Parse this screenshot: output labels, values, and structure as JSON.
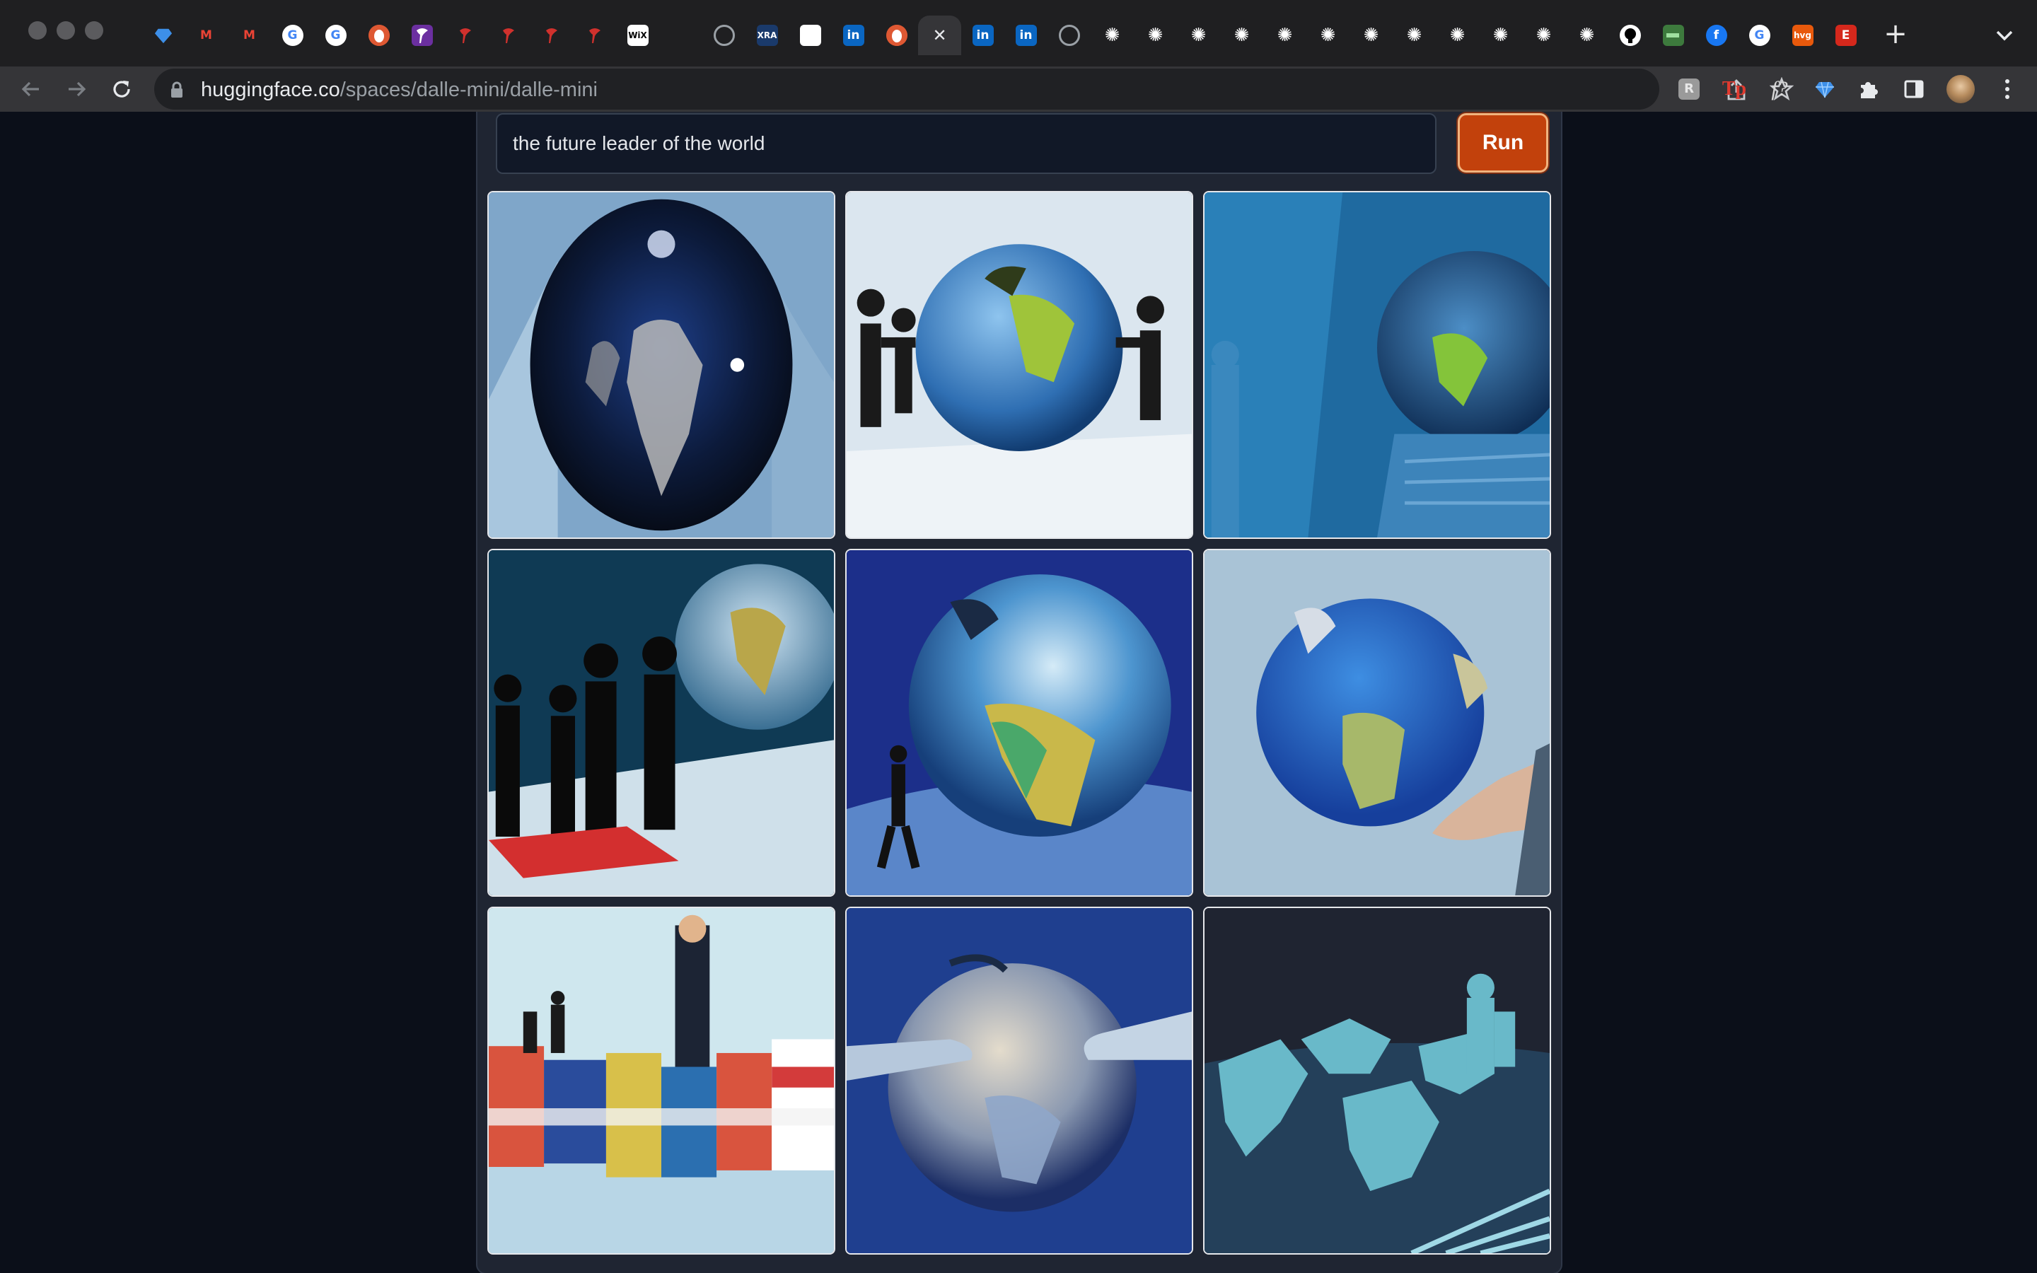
{
  "browser": {
    "url_host": "huggingface.co",
    "url_path": "/spaces/dalle-mini/dalle-mini",
    "tabs": [
      {
        "icon": "diamond-icon",
        "label": "",
        "bg": "transparent",
        "color": "#4a90e2"
      },
      {
        "icon": "gmail-icon",
        "label": "M",
        "bg": "transparent",
        "color": "#ea4335"
      },
      {
        "icon": "gmail-icon",
        "label": "M",
        "bg": "transparent",
        "color": "#ea4335"
      },
      {
        "icon": "google-icon",
        "label": "G",
        "bg": "#ffffff",
        "color": "#4285f4"
      },
      {
        "icon": "google-icon",
        "label": "G",
        "bg": "#ffffff",
        "color": "#4285f4"
      },
      {
        "icon": "duckduckgo-icon",
        "label": "",
        "bg": "#de5833",
        "color": "#ffffff"
      },
      {
        "icon": "purple-pin-icon",
        "label": "",
        "bg": "#6b2fa0",
        "color": "#ffffff"
      },
      {
        "icon": "red-pin-icon",
        "label": "",
        "bg": "transparent",
        "color": "#d0312d"
      },
      {
        "icon": "red-pin-icon",
        "label": "",
        "bg": "transparent",
        "color": "#d0312d"
      },
      {
        "icon": "red-pin-icon",
        "label": "",
        "bg": "transparent",
        "color": "#d0312d"
      },
      {
        "icon": "red-pin-icon",
        "label": "",
        "bg": "transparent",
        "color": "#d0312d"
      },
      {
        "icon": "wix-icon",
        "label": "WiX",
        "bg": "#ffffff",
        "color": "#000000"
      },
      {
        "icon": "blank-icon",
        "label": "",
        "bg": "transparent",
        "color": "#ffffff"
      },
      {
        "icon": "globe-icon",
        "label": "",
        "bg": "transparent",
        "color": "#9aa0a6"
      },
      {
        "icon": "xra-icon",
        "label": "XRA",
        "bg": "#1a3a6b",
        "color": "#ffffff"
      },
      {
        "icon": "white-square-icon",
        "label": "",
        "bg": "#ffffff",
        "color": "#ffffff"
      },
      {
        "icon": "linkedin-icon",
        "label": "in",
        "bg": "#0a66c2",
        "color": "#ffffff"
      },
      {
        "icon": "duckduckgo-icon",
        "label": "",
        "bg": "#de5833",
        "color": "#ffffff"
      },
      {
        "icon": "close-icon",
        "label": "✕",
        "bg": "transparent",
        "color": "#e8eaed",
        "active": true
      },
      {
        "icon": "linkedin-icon",
        "label": "in",
        "bg": "#0a66c2",
        "color": "#ffffff"
      },
      {
        "icon": "linkedin-icon",
        "label": "in",
        "bg": "#0a66c2",
        "color": "#ffffff"
      },
      {
        "icon": "globe-icon",
        "label": "",
        "bg": "transparent",
        "color": "#9aa0a6"
      },
      {
        "icon": "gear-icon",
        "label": "✺",
        "bg": "transparent",
        "color": "#ffffff"
      },
      {
        "icon": "gear-icon",
        "label": "✺",
        "bg": "transparent",
        "color": "#ffffff"
      },
      {
        "icon": "gear-icon",
        "label": "✺",
        "bg": "transparent",
        "color": "#ffffff"
      },
      {
        "icon": "gear-icon",
        "label": "✺",
        "bg": "transparent",
        "color": "#ffffff"
      },
      {
        "icon": "gear-icon",
        "label": "✺",
        "bg": "transparent",
        "color": "#ffffff"
      },
      {
        "icon": "gear-icon",
        "label": "✺",
        "bg": "transparent",
        "color": "#ffffff"
      },
      {
        "icon": "gear-icon",
        "label": "✺",
        "bg": "transparent",
        "color": "#ffffff"
      },
      {
        "icon": "gear-icon",
        "label": "✺",
        "bg": "transparent",
        "color": "#ffffff"
      },
      {
        "icon": "gear-icon",
        "label": "✺",
        "bg": "transparent",
        "color": "#ffffff"
      },
      {
        "icon": "gear-icon",
        "label": "✺",
        "bg": "transparent",
        "color": "#ffffff"
      },
      {
        "icon": "gear-icon",
        "label": "✺",
        "bg": "transparent",
        "color": "#ffffff"
      },
      {
        "icon": "gear-icon",
        "label": "✺",
        "bg": "transparent",
        "color": "#ffffff"
      },
      {
        "icon": "github-icon",
        "label": "",
        "bg": "#ffffff",
        "color": "#000000"
      },
      {
        "icon": "battery-icon",
        "label": "",
        "bg": "#3d7a3d",
        "color": "#9fe09f"
      },
      {
        "icon": "facebook-icon",
        "label": "f",
        "bg": "#1877f2",
        "color": "#ffffff"
      },
      {
        "icon": "google-icon",
        "label": "G",
        "bg": "#ffffff",
        "color": "#4285f4"
      },
      {
        "icon": "hvg-icon",
        "label": "hvg",
        "bg": "#e8590c",
        "color": "#ffffff"
      },
      {
        "icon": "etsy-icon",
        "label": "E",
        "bg": "#d5281c",
        "color": "#ffffff"
      }
    ],
    "extensions": [
      {
        "icon": "r-extension-icon",
        "label": "R"
      },
      {
        "icon": "tp-extension-icon",
        "label": "Tp"
      },
      {
        "icon": "fx-extension-icon",
        "label": "f?"
      },
      {
        "icon": "diamond-extension-icon",
        "label": ""
      },
      {
        "icon": "puzzle-icon",
        "label": ""
      },
      {
        "icon": "sidepanel-icon",
        "label": ""
      },
      {
        "icon": "profile-avatar-icon",
        "label": ""
      },
      {
        "icon": "kebab-menu-icon",
        "label": "⋮"
      }
    ]
  },
  "app": {
    "prompt_value": "the future leader of the world",
    "run_label": "Run",
    "accent": "#c2410c",
    "images": [
      {
        "name": "glass-globe-map-image"
      },
      {
        "name": "figures-around-globe-image"
      },
      {
        "name": "globe-in-blue-room-image"
      },
      {
        "name": "silhouettes-with-globe-image"
      },
      {
        "name": "walking-figure-globe-image"
      },
      {
        "name": "hand-holding-globe-image"
      },
      {
        "name": "leader-on-flags-image"
      },
      {
        "name": "hands-holding-globe-image"
      },
      {
        "name": "world-map-figures-image"
      }
    ]
  }
}
